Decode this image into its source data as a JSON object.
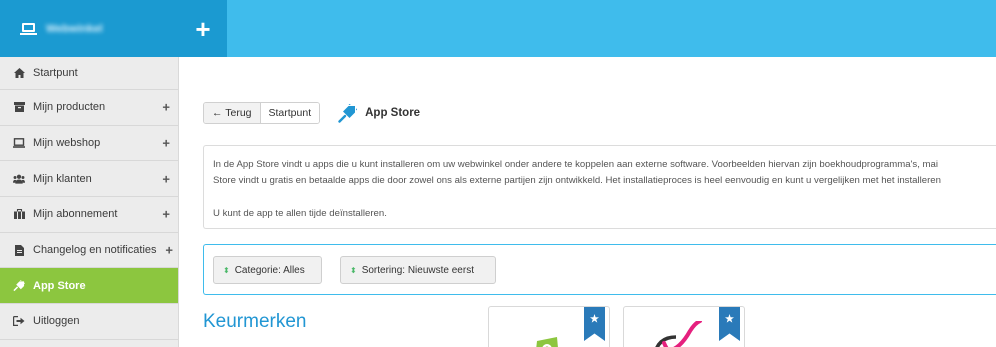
{
  "header": {
    "shop_name": "Webwinkel",
    "add_label": "+"
  },
  "sidebar": {
    "items": [
      {
        "label": "Startpunt",
        "icon": "home-icon",
        "expandable": false
      },
      {
        "label": "Mijn producten",
        "icon": "box-icon",
        "expandable": true
      },
      {
        "label": "Mijn webshop",
        "icon": "laptop-icon",
        "expandable": true
      },
      {
        "label": "Mijn klanten",
        "icon": "users-icon",
        "expandable": true
      },
      {
        "label": "Mijn abonnement",
        "icon": "briefcase-icon",
        "expandable": true
      },
      {
        "label": "Changelog en notificaties",
        "icon": "document-icon",
        "expandable": true
      },
      {
        "label": "App Store",
        "icon": "plug-icon",
        "expandable": false,
        "active": true
      },
      {
        "label": "Uitloggen",
        "icon": "sign-out-icon",
        "expandable": false
      }
    ],
    "plus_symbol": "+"
  },
  "breadcrumb": {
    "back_label": "← Terug",
    "home_label": "Startpunt"
  },
  "page_title": "App Store",
  "info": {
    "line1": "In de App Store vindt u apps die u kunt installeren om uw webwinkel onder andere te koppelen aan externe software. Voorbeelden hiervan zijn boekhoudprogramma's, mai",
    "line2": "Store vindt u gratis en betaalde apps die door zowel ons als externe partijen zijn ontwikkeld. Het installatieproces is heel eenvoudig en kunt u vergelijken met het installeren",
    "line3": "U kunt de app te allen tijde deïnstalleren."
  },
  "filters": {
    "category_label": "Categorie: Alles",
    "sort_label": "Sortering: Nieuwste eerst",
    "caret_symbol": "⬍"
  },
  "section": {
    "title": "Keurmerken"
  },
  "colors": {
    "topbar": "#3fbcec",
    "brand": "#1b9ad1",
    "active_nav": "#8cc63f",
    "accent_blue": "#2196d3",
    "ribbon": "#2a7ab9"
  }
}
